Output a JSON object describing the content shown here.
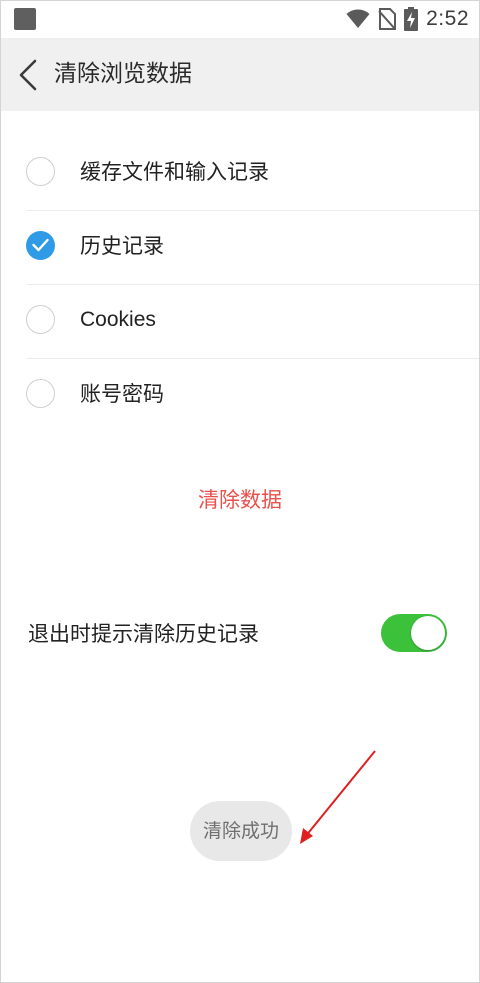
{
  "status_bar": {
    "time": "2:52",
    "icons": [
      "app-notification-icon",
      "wifi-icon",
      "no-sim-icon",
      "battery-charging-icon"
    ]
  },
  "header": {
    "back_icon": "chevron-left-icon",
    "title": "清除浏览数据"
  },
  "options": [
    {
      "label": "缓存文件和输入记录",
      "checked": false
    },
    {
      "label": "历史记录",
      "checked": true
    },
    {
      "label": "Cookies",
      "checked": false
    },
    {
      "label": "账号密码",
      "checked": false
    }
  ],
  "clear_button": {
    "label": "清除数据",
    "color": "#e8514c"
  },
  "exit_prompt_setting": {
    "label": "退出时提示清除历史记录",
    "enabled": true,
    "toggle_color": "#3cc13b"
  },
  "toast": {
    "message": "清除成功"
  },
  "colors": {
    "accent_blue": "#2f9ae5",
    "header_bg": "#f0f0f0",
    "annotation_red": "#e02020"
  }
}
